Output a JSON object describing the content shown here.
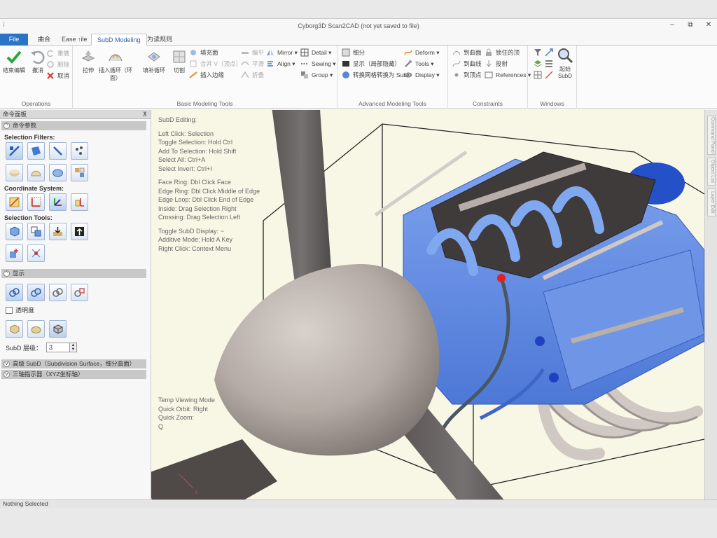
{
  "window": {
    "title": "Cyborg3D Scan2CAD  (not yet saved to file)",
    "minimize": "–",
    "restore": "⧉",
    "close": "✕"
  },
  "tabs": {
    "file": "File",
    "home": "曲合",
    "tab3": "Ease ↑ile",
    "subd": "SubD Modeling",
    "tab5": "为读规则"
  },
  "ribbon": {
    "operations": {
      "label": "Operations",
      "finish": "结束编辑",
      "undo": "撤消",
      "redo": "重做",
      "delete": "删除",
      "clear": "取消"
    },
    "basic": {
      "label": "Basic Modeling Tools",
      "btn1": "拉伸",
      "btn2": "插入循环（环面）",
      "btn3": "填补循环",
      "btn4": "切割",
      "s1": "填充面",
      "s2": "合并 V（顶点）",
      "s3": "插入边缘",
      "s4": "编平",
      "s5": "平滑",
      "s6": "折叠",
      "mirror": "Mirror",
      "align": "Align",
      "detail": "Detail",
      "sewing": "Sewing",
      "group": "Group"
    },
    "advanced": {
      "label": "Advanced Modeling Tools",
      "s1": "细分",
      "s2": "显示（局部隐藏）",
      "s3": "转换网格转换为 SubD",
      "deform": "Deform",
      "tools": "Tools",
      "display": "Display"
    },
    "constraints": {
      "label": "Constraints",
      "s1": "到曲面",
      "s2": "到曲线",
      "s3": "到顶点",
      "s4": "锁住的顶",
      "s5": "投射",
      "references": "References"
    },
    "windows": {
      "label": "Windows",
      "subd": "起始 SubD"
    }
  },
  "panel": {
    "title": "命令面板",
    "pin": "⊼",
    "section_params": "命令参数",
    "selection_filters": "Selection Filters:",
    "coordinate_system": "Coordinate System:",
    "selection_tools": "Selection Tools:",
    "section_display": "显示",
    "transparency": "透明度",
    "subd_level_label": "SubD 层级：",
    "subd_level_value": "3",
    "section_subd": "高级 SubD（Subdivision Surface，细分曲面）",
    "section_xyz": "三轴指示器（XYZ坐标轴）"
  },
  "viewport": {
    "help": [
      "SubD Editing:",
      "",
      "Left Click: Selection",
      "Toggle Selection: Hold Ctrl",
      "Add To Selection: Hold Shift",
      "Select All: Ctrl+A",
      "Select Invert: Ctrl+I",
      "",
      "Face Ring: Dbl Click Face",
      "Edge Ring: Dbl Click Middle of Edge",
      "Edge Loop: Dbl Click End of Edge",
      "Inside: Drag Selection Right",
      "Crossing: Drag Selection Left",
      "",
      "Toggle SubD Display: ~",
      "Additive Mode: Hold A Key",
      "Right Click: Context Menu"
    ],
    "temp": [
      "Temp Viewing Mode",
      "Quick Orbit: Right",
      "Quick Zoom:",
      "Q"
    ],
    "axis": "x"
  },
  "right_tabs": [
    "Command Panel",
    "Object List",
    "Layer Edit"
  ],
  "status": "Nothing Selected",
  "colors": {
    "accent": "#2b73c6",
    "engine_blue": "#5a86e0",
    "spinner_gray": "#b4aba6",
    "viewport_bg": "#f8f7e6"
  }
}
